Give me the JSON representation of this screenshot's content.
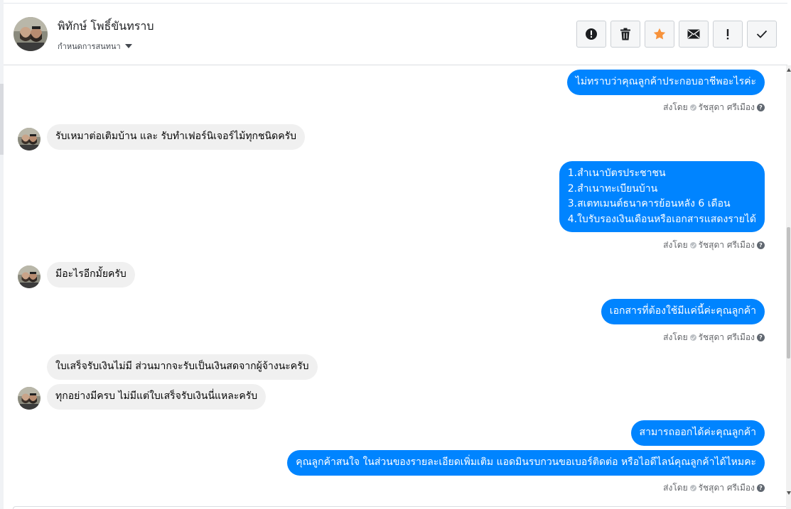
{
  "header": {
    "contact_name": "พิทักษ์ โพธิ์ขันทราบ",
    "assign_label": "กำหนดการสนทนา",
    "actions": [
      {
        "icon": "alert-circle-icon",
        "label": "Mark as spam"
      },
      {
        "icon": "trash-icon",
        "label": "Delete"
      },
      {
        "icon": "star-icon",
        "label": "Star"
      },
      {
        "icon": "mail-icon",
        "label": "Mark as unread"
      },
      {
        "icon": "exclamation-icon",
        "label": "Follow up"
      },
      {
        "icon": "checkmark-icon",
        "label": "Mark as done"
      }
    ]
  },
  "colors": {
    "outgoing_bubble": "#0084ff",
    "incoming_bubble": "#f0f0f0",
    "star_accent": "#f7923b"
  },
  "messages": [
    {
      "direction": "out",
      "text": "ไม่ทราบว่าคุณลูกค้าประกอบอาชีพอะไรค่ะ"
    },
    {
      "direction": "in",
      "text": "รับเหมาต่อเติมบ้าน และ รับทำเฟอร์นิเจอร์ไม้ทุกชนิดครับ"
    },
    {
      "direction": "out",
      "lines": [
        "1.สำเนาบัตรประชาชน",
        "2.สำเนาทะเบียนบ้าน",
        "3.สเตทเมนต์ธนาคารย้อนหลัง 6 เดือน",
        "4.ใบรับรองเงินเดือนหรือเอกสารแสดงรายได้"
      ]
    },
    {
      "direction": "in",
      "text": "มีอะไรอีกมั้ยครับ"
    },
    {
      "direction": "out",
      "text": "เอกสารที่ต้องใช้มีแค่นี้ค่ะคุณลูกค้า"
    },
    {
      "direction": "in",
      "text": "ใบเสร็จรับเงินไม่มี ส่วนมากจะรับเป็นเงินสดจากผู้จ้างนะครับ"
    },
    {
      "direction": "in",
      "text": "ทุกอย่างมีครบ ไม่มีแต่ใบเสร็จรับเงินนี่แหละครับ"
    },
    {
      "direction": "out",
      "text": "สามารถออกได้ค่ะคุณลูกค้า"
    },
    {
      "direction": "out",
      "text": "คุณลูกค้าสนใจ ในส่วนของรายละเอียดเพิ่มเติม แอดมินรบกวนขอเบอร์ติดต่อ หรือไอดีไลน์คุณลูกค้าได้ไหมคะ"
    }
  ],
  "sent_by": {
    "prefix": "ส่งโดย",
    "agent": "รัชสุดา ศรีเมือง"
  }
}
